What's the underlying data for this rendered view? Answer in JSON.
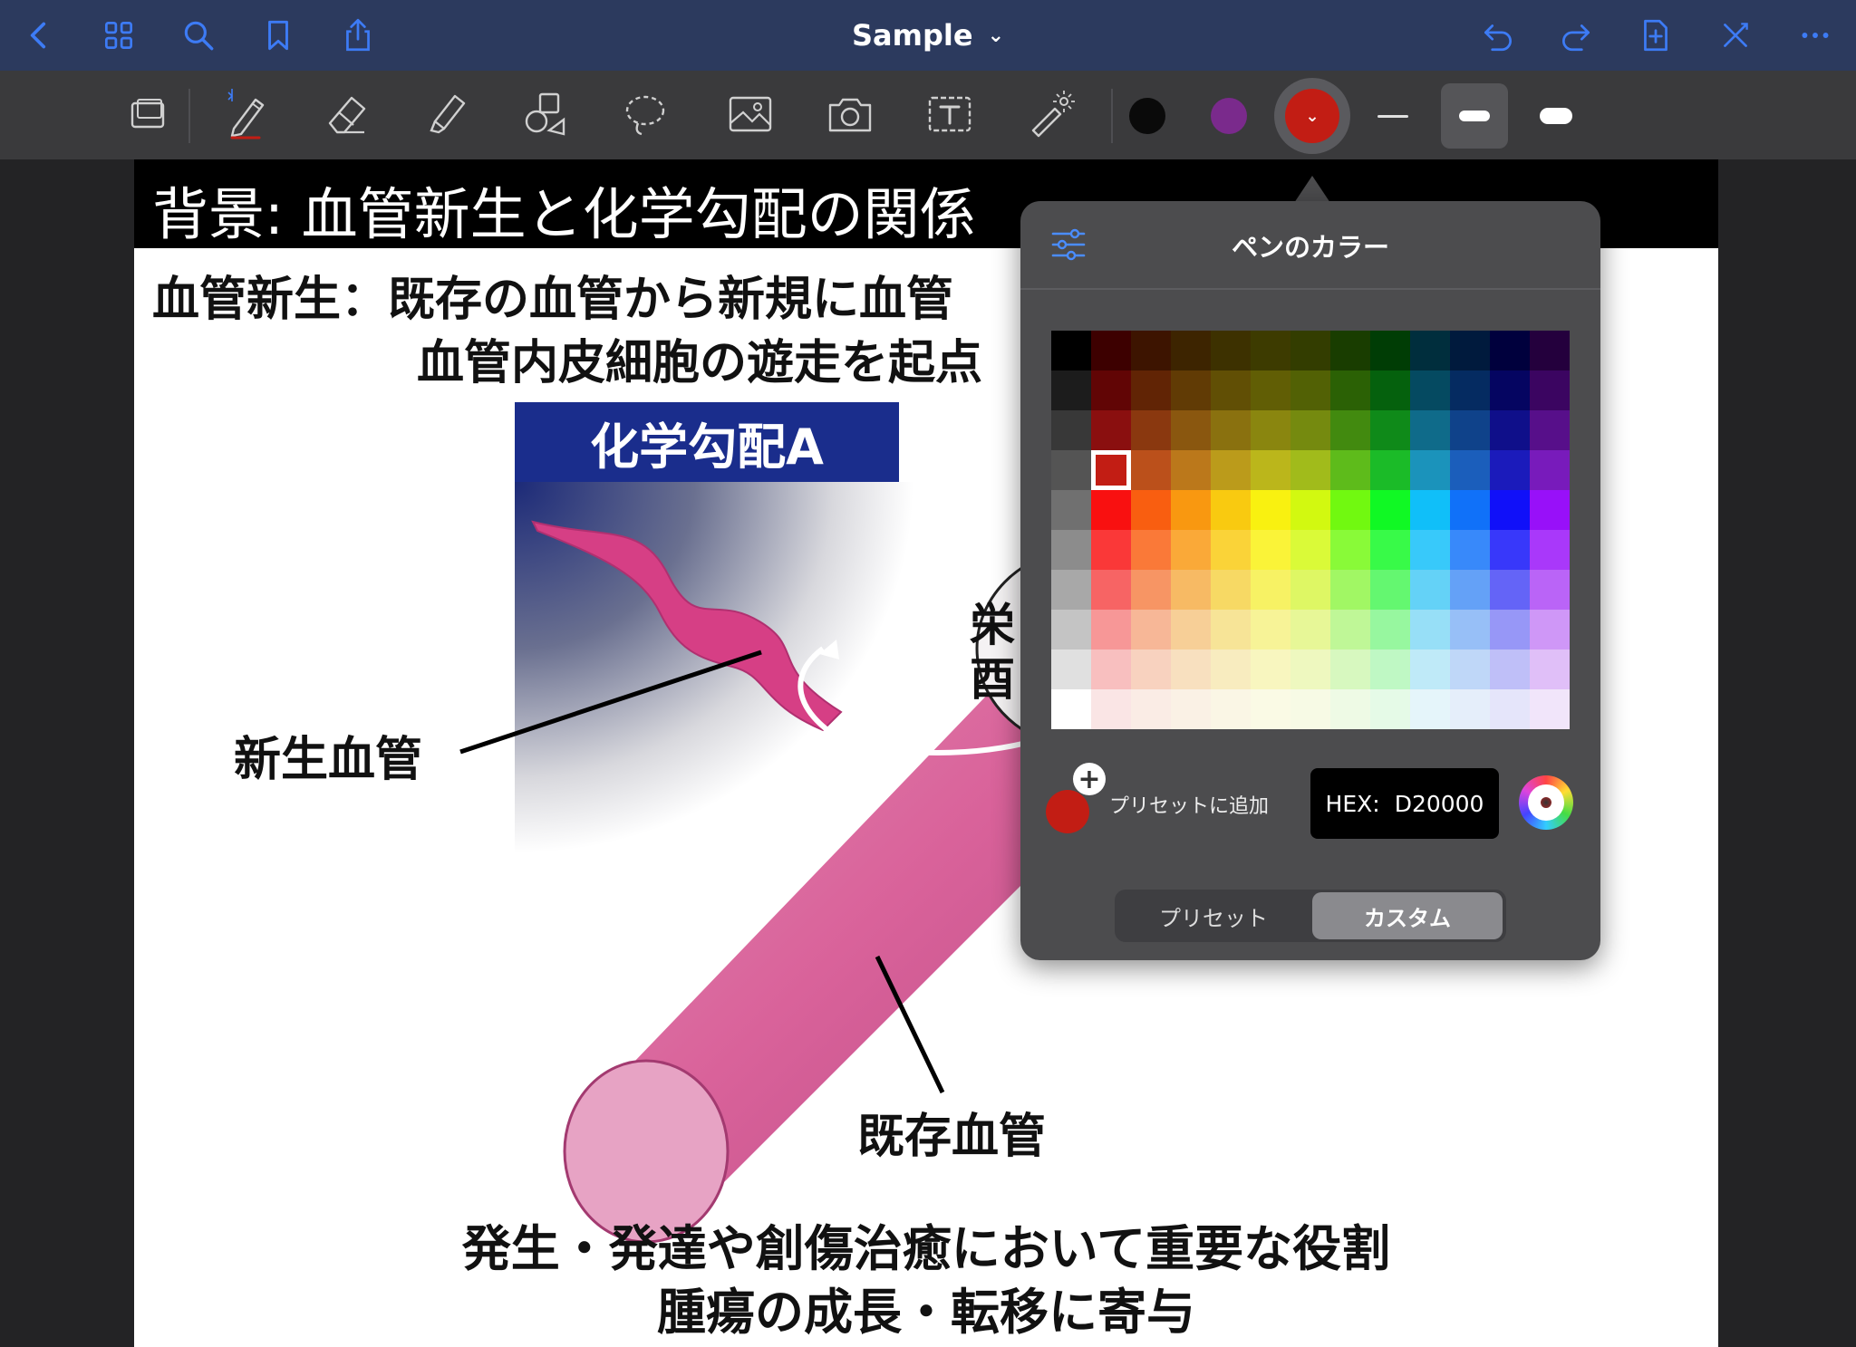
{
  "topbar": {
    "title": "Sample"
  },
  "toolbar": {
    "colors": {
      "black": "#0a0a0a",
      "purple": "#7a2a8c",
      "selected": "#c21d14"
    }
  },
  "slide": {
    "title": "背景: 血管新生と化学勾配の関係",
    "heading_line1": "血管新生：既存の血管から新規に血管",
    "heading_line2": "血管内皮細胞の遊走を起点",
    "gradient_label": "化学勾配A",
    "callout_partial_1": "栄",
    "callout_partial_2": "酉",
    "new_vessel_label": "新生血管",
    "existing_vessel_label": "既存血管",
    "footer_line1": "発生・発達や創傷治癒において重要な役割",
    "footer_line2": "腫瘍の成長・転移に寄与"
  },
  "color_popover": {
    "title": "ペンのカラー",
    "add_preset_label": "プリセットに追加",
    "hex_label": "HEX:",
    "hex_value": "D20000",
    "segments": [
      "プリセット",
      "カスタム"
    ],
    "active_segment": "カスタム",
    "selected_color": "#c21d14"
  }
}
